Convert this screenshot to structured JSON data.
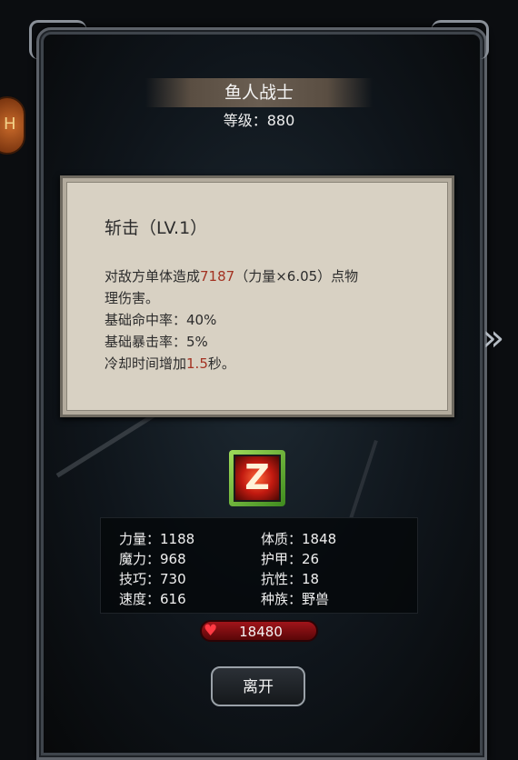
{
  "monster": {
    "name": "鱼人战士",
    "level_label": "等级：",
    "level_value": "880"
  },
  "skill": {
    "title": "斩击（LV.1）",
    "line1_prefix": "对敌方单体造成",
    "damage": "7187",
    "line1_suffix": "（力量×6.05）点物",
    "line2": "理伤害。",
    "hit_rate": "基础命中率：40%",
    "crit_rate": "基础暴击率：5%",
    "cooldown_prefix": "冷却时间增加",
    "cooldown_value": "1.5",
    "cooldown_suffix": "秒。",
    "icon": "slash-skill-icon",
    "icon_glyph": "Z"
  },
  "stats": {
    "left": [
      "力量：1188",
      "魔力：968",
      "技巧：730",
      "速度：616"
    ],
    "right": [
      "体质：1848",
      "护甲：26",
      "抗性：18",
      "种族：野兽"
    ]
  },
  "hp": {
    "value": "18480",
    "icon": "heart-icon"
  },
  "buttons": {
    "leave": "离开"
  },
  "nav": {
    "next_icon": "double-chevron-right-icon",
    "next_glyph": "»",
    "side_tab_glyph": "H"
  },
  "colors": {
    "damage_highlight": "#a33222",
    "skill_box_bg": "#d8d1c3",
    "hp_bar": "#a0141a"
  }
}
